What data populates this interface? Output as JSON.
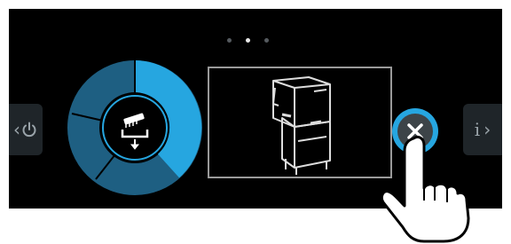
{
  "pagination": {
    "total": 3,
    "active_index": 1
  },
  "navigation": {
    "back_icon": "chevron-left-icon",
    "power_icon": "power-icon",
    "info_icon": "info-icon",
    "forward_icon": "chevron-right-icon",
    "back_glyph": "‹",
    "info_glyph": "i",
    "forward_glyph": "›"
  },
  "program_progress": {
    "icon": "wash-brush-icon",
    "segments": [
      "#26a6e0",
      "#1e5f82",
      "#1e5f82",
      "#1e5f82"
    ],
    "active_fraction": 0.38
  },
  "machine": {
    "icon": "hood-dishwasher-icon"
  },
  "close_action": {
    "icon": "close-icon"
  },
  "colors": {
    "accent": "#26a6e0",
    "segment_dim": "#1e5f82",
    "background": "#000000"
  }
}
